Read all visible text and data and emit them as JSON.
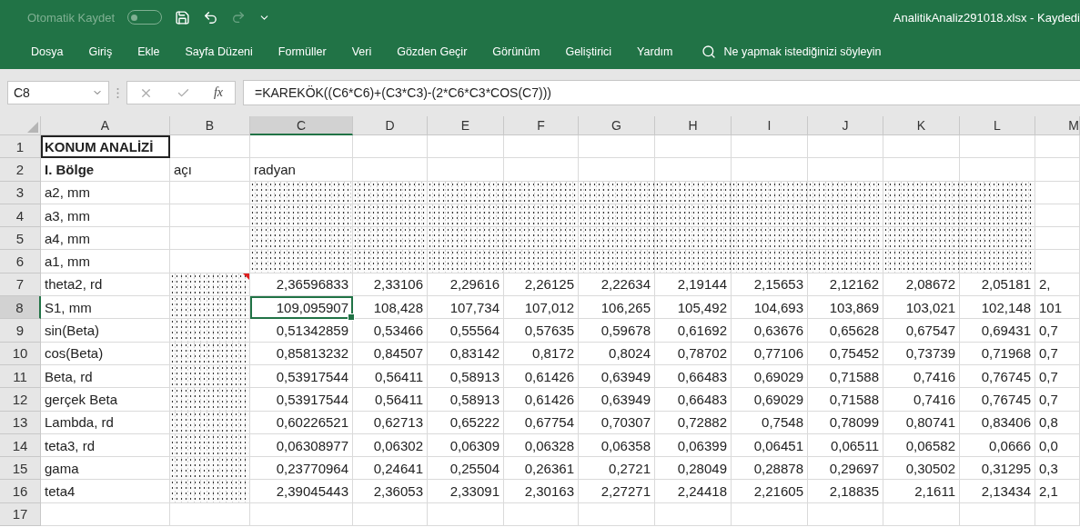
{
  "title_bar": {
    "autosave_label": "Otomatik Kaydet",
    "autosave_on": false,
    "title": "AnalitikAnaliz291018.xlsx  -  Kaydedi"
  },
  "ribbon_tabs": [
    {
      "label": "Dosya"
    },
    {
      "label": "Giriş"
    },
    {
      "label": "Ekle"
    },
    {
      "label": "Sayfa Düzeni"
    },
    {
      "label": "Formüller"
    },
    {
      "label": "Veri"
    },
    {
      "label": "Gözden Geçir"
    },
    {
      "label": "Görünüm"
    },
    {
      "label": "Geliştirici"
    },
    {
      "label": "Yardım"
    }
  ],
  "tell_me": {
    "placeholder": "Ne yapmak istediğinizi söyleyin"
  },
  "formula_bar": {
    "name_box": "C8",
    "fx": "fx",
    "formula": "=KAREKÖK((C6*C6)+(C3*C3)-(2*C6*C3*COS(C7)))"
  },
  "columns": [
    {
      "label": "A",
      "selected": false
    },
    {
      "label": "B",
      "selected": false
    },
    {
      "label": "C",
      "selected": true
    },
    {
      "label": "D",
      "selected": false
    },
    {
      "label": "E",
      "selected": false
    },
    {
      "label": "F",
      "selected": false
    },
    {
      "label": "G",
      "selected": false
    },
    {
      "label": "H",
      "selected": false
    },
    {
      "label": "I",
      "selected": false
    },
    {
      "label": "J",
      "selected": false
    },
    {
      "label": "K",
      "selected": false
    },
    {
      "label": "L",
      "selected": false
    },
    {
      "label": "M",
      "selected": false
    }
  ],
  "rows": [
    {
      "num": "1",
      "kind": "text",
      "selected": false,
      "label_bold": true,
      "cells": [
        "KONUM ANALİZİ"
      ]
    },
    {
      "num": "2",
      "kind": "text",
      "selected": false,
      "label_bold": true,
      "cells": [
        "I. Bölge",
        "açı",
        "radyan"
      ]
    },
    {
      "num": "3",
      "kind": "text",
      "selected": false,
      "values_obscured": true,
      "cells": [
        "a2, mm"
      ]
    },
    {
      "num": "4",
      "kind": "text",
      "selected": false,
      "values_obscured": true,
      "cells": [
        "a3, mm"
      ]
    },
    {
      "num": "5",
      "kind": "text",
      "selected": false,
      "values_obscured": true,
      "cells": [
        "a4, mm"
      ]
    },
    {
      "num": "6",
      "kind": "text",
      "selected": false,
      "values_obscured": true,
      "cells": [
        "a1, mm"
      ]
    },
    {
      "num": "7",
      "kind": "numeric",
      "selected": false,
      "angle_obscured": true,
      "comment": true,
      "cells": [
        "theta2, rd",
        "",
        "2,36596833",
        "2,33106",
        "2,29616",
        "2,26125",
        "2,22634",
        "2,19144",
        "2,15653",
        "2,12162",
        "2,08672",
        "2,05181",
        "2,"
      ]
    },
    {
      "num": "8",
      "kind": "numeric",
      "selected": true,
      "angle_obscured": true,
      "cells": [
        "S1, mm",
        "",
        "109,095907",
        "108,428",
        "107,734",
        "107,012",
        "106,265",
        "105,492",
        "104,693",
        "103,869",
        "103,021",
        "102,148",
        "101"
      ]
    },
    {
      "num": "9",
      "kind": "numeric",
      "selected": false,
      "angle_obscured": true,
      "cells": [
        "sin(Beta)",
        "",
        "0,51342859",
        "0,53466",
        "0,55564",
        "0,57635",
        "0,59678",
        "0,61692",
        "0,63676",
        "0,65628",
        "0,67547",
        "0,69431",
        "0,7"
      ]
    },
    {
      "num": "10",
      "kind": "numeric",
      "selected": false,
      "angle_obscured": true,
      "cells": [
        "cos(Beta)",
        "",
        "0,85813232",
        "0,84507",
        "0,83142",
        "0,8172",
        "0,8024",
        "0,78702",
        "0,77106",
        "0,75452",
        "0,73739",
        "0,71968",
        "0,7"
      ]
    },
    {
      "num": "11",
      "kind": "numeric",
      "selected": false,
      "angle_obscured": true,
      "cells": [
        "Beta, rd",
        "",
        "0,53917544",
        "0,56411",
        "0,58913",
        "0,61426",
        "0,63949",
        "0,66483",
        "0,69029",
        "0,71588",
        "0,7416",
        "0,76745",
        "0,7"
      ]
    },
    {
      "num": "12",
      "kind": "numeric",
      "selected": false,
      "angle_obscured": true,
      "cells": [
        "gerçek Beta",
        "",
        "0,53917544",
        "0,56411",
        "0,58913",
        "0,61426",
        "0,63949",
        "0,66483",
        "0,69029",
        "0,71588",
        "0,7416",
        "0,76745",
        "0,7"
      ]
    },
    {
      "num": "13",
      "kind": "numeric",
      "selected": false,
      "angle_obscured": true,
      "cells": [
        "Lambda, rd",
        "",
        "0,60226521",
        "0,62713",
        "0,65222",
        "0,67754",
        "0,70307",
        "0,72882",
        "0,7548",
        "0,78099",
        "0,80741",
        "0,83406",
        "0,8"
      ]
    },
    {
      "num": "14",
      "kind": "numeric",
      "selected": false,
      "angle_obscured": true,
      "cells": [
        "teta3, rd",
        "",
        "0,06308977",
        "0,06302",
        "0,06309",
        "0,06328",
        "0,06358",
        "0,06399",
        "0,06451",
        "0,06511",
        "0,06582",
        "0,0666",
        "0,0"
      ]
    },
    {
      "num": "15",
      "kind": "numeric",
      "selected": false,
      "angle_obscured": true,
      "cells": [
        "gama",
        "",
        "0,23770964",
        "0,24641",
        "0,25504",
        "0,26361",
        "0,2721",
        "0,28049",
        "0,28878",
        "0,29697",
        "0,30502",
        "0,31295",
        "0,3"
      ]
    },
    {
      "num": "16",
      "kind": "numeric",
      "selected": false,
      "angle_obscured": true,
      "cells": [
        "teta4",
        "",
        "2,39045443",
        "2,36053",
        "2,33091",
        "2,30163",
        "2,27271",
        "2,24418",
        "2,21605",
        "2,18835",
        "2,1611",
        "2,13434",
        "2,1"
      ]
    },
    {
      "num": "17",
      "kind": "text",
      "selected": false,
      "cells": []
    }
  ]
}
